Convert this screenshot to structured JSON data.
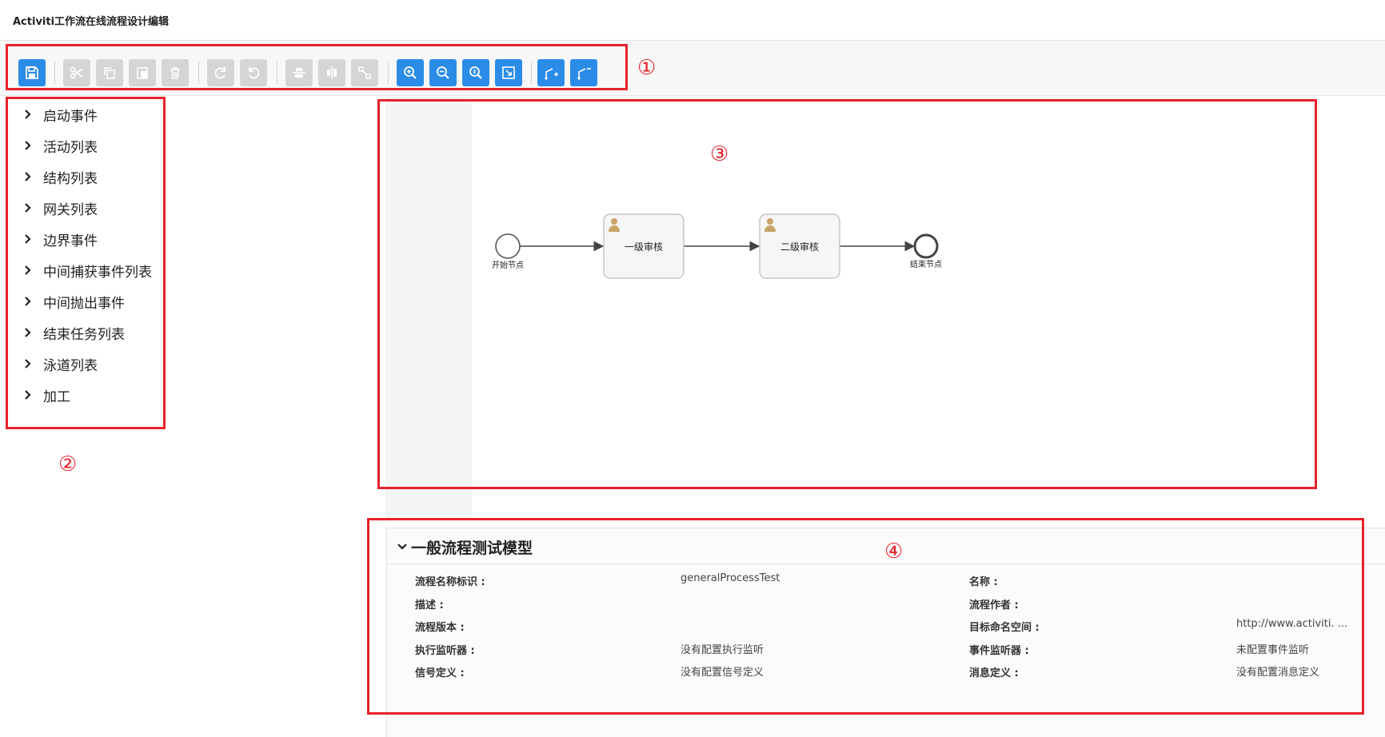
{
  "app": {
    "title": "Activiti工作流在线流程设计编辑"
  },
  "toolbar": {
    "buttons": [
      {
        "icon": "save-icon",
        "enabled": true
      },
      {
        "icon": "cut-icon",
        "enabled": false
      },
      {
        "icon": "copy-icon",
        "enabled": false
      },
      {
        "icon": "paste-icon",
        "enabled": false
      },
      {
        "icon": "delete-icon",
        "enabled": false
      },
      {
        "icon": "redo-icon",
        "enabled": false
      },
      {
        "icon": "undo-icon",
        "enabled": false
      },
      {
        "icon": "align-horizontal-icon",
        "enabled": false
      },
      {
        "icon": "align-vertical-icon",
        "enabled": false
      },
      {
        "icon": "same-size-icon",
        "enabled": false
      },
      {
        "icon": "zoom-in-icon",
        "enabled": true
      },
      {
        "icon": "zoom-out-icon",
        "enabled": true
      },
      {
        "icon": "zoom-actual-icon",
        "enabled": true
      },
      {
        "icon": "zoom-fit-icon",
        "enabled": true
      },
      {
        "icon": "add-bendpoint-icon",
        "enabled": true
      },
      {
        "icon": "remove-bendpoint-icon",
        "enabled": true
      }
    ]
  },
  "palette": {
    "items": [
      "启动事件",
      "活动列表",
      "结构列表",
      "网关列表",
      "边界事件",
      "中间捕获事件列表",
      "中间抛出事件",
      "结束任务列表",
      "泳道列表",
      "加工"
    ]
  },
  "diagram": {
    "start": {
      "label": "开始节点"
    },
    "tasks": [
      {
        "label": "一级审核"
      },
      {
        "label": "二级审核"
      }
    ],
    "end": {
      "label": "结束节点"
    }
  },
  "properties": {
    "title": "一般流程测试模型",
    "rows": [
      {
        "label": "流程名称标识 :",
        "value": "generalProcessTest",
        "label2": "名称 :",
        "value2": ""
      },
      {
        "label": "描述 :",
        "value": "",
        "label2": "流程作者 :",
        "value2": ""
      },
      {
        "label": "流程版本 :",
        "value": "",
        "label2": "目标命名空间 :",
        "value2": "http://www.activiti. ..."
      },
      {
        "label": "执行监听器 :",
        "value": "没有配置执行监听",
        "label2": "事件监听器 :",
        "value2": "未配置事件监听"
      },
      {
        "label": "信号定义 :",
        "value": "没有配置信号定义",
        "label2": "消息定义 :",
        "value2": "没有配置消息定义"
      }
    ]
  },
  "annotations": [
    "①",
    "②",
    "③",
    "④"
  ],
  "colors": {
    "accent": "#2b8ce8",
    "annotation": "#e8212b",
    "disabled": "#d5d5d5"
  }
}
